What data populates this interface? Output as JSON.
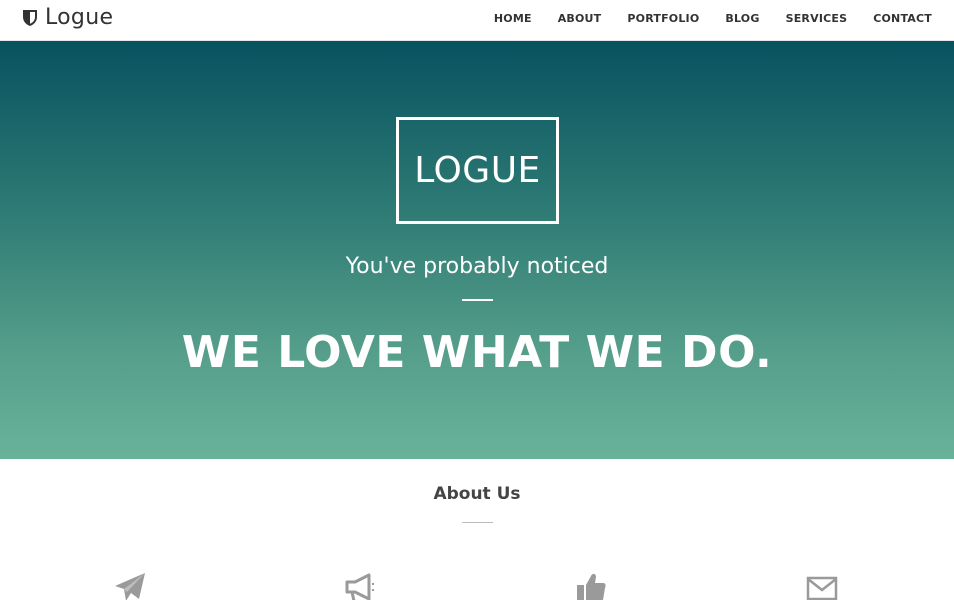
{
  "brand": {
    "name": "Logue",
    "icon": "shield-icon"
  },
  "nav": {
    "items": [
      {
        "label": "HOME"
      },
      {
        "label": "ABOUT"
      },
      {
        "label": "PORTFOLIO"
      },
      {
        "label": "BLOG"
      },
      {
        "label": "SERVICES"
      },
      {
        "label": "CONTACT"
      }
    ]
  },
  "hero": {
    "logo_text": "LOGUE",
    "tagline": "You've probably noticed",
    "headline": "WE LOVE WHAT WE DO."
  },
  "about": {
    "title": "About Us",
    "icons": [
      "paper-plane-icon",
      "megaphone-icon",
      "thumbs-up-icon",
      "envelope-icon"
    ]
  },
  "colors": {
    "hero_top": "#075260",
    "hero_bottom": "#69b29a",
    "text_dark": "#333333",
    "icon_gray": "#9a9a9a"
  }
}
